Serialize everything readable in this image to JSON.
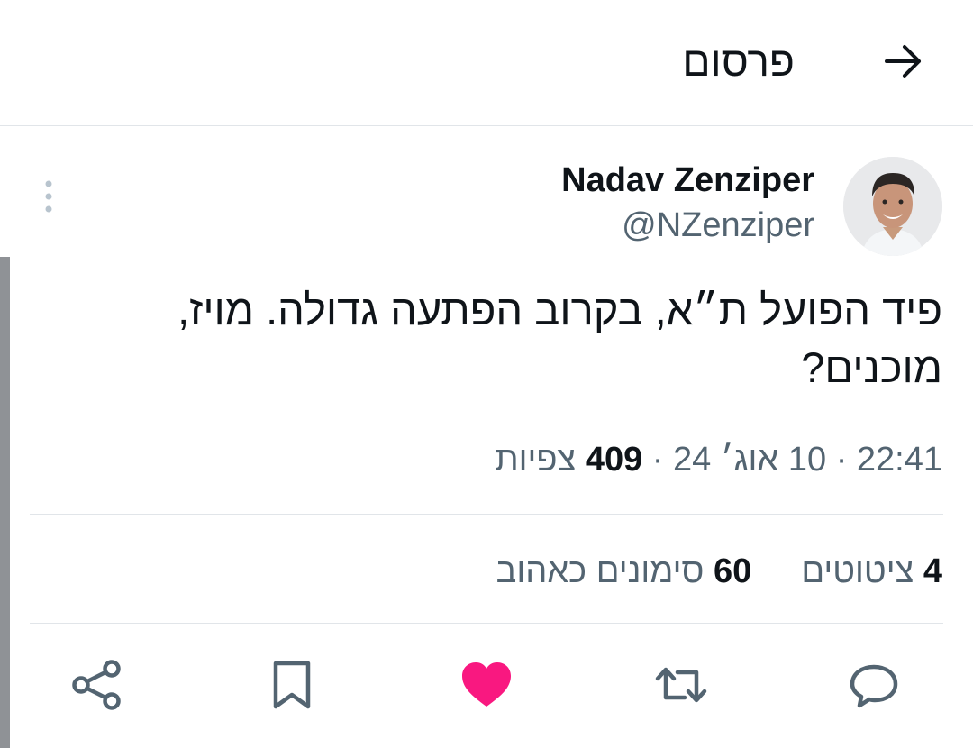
{
  "header": {
    "title": "פרסום",
    "back_icon": "arrow-right-icon"
  },
  "tweet": {
    "author_name": "Nadav Zenziper",
    "author_handle": "@NZenziper",
    "text": "פיד הפועל ת״א, בקרוב הפתעה גדולה. מויז, מוכנים?",
    "time": "22:41",
    "date": "10 אוג׳ 24",
    "views_count": "409",
    "views_label": "צפיות",
    "separator": "·"
  },
  "stats": {
    "quotes_count": "4",
    "quotes_label": "ציטוטים",
    "likes_count": "60",
    "likes_label": "סימונים כאהוב"
  },
  "actions": {
    "reply_icon": "reply-icon",
    "retweet_icon": "retweet-icon",
    "like_icon": "heart-icon",
    "bookmark_icon": "bookmark-icon",
    "share_icon": "share-icon",
    "like_color": "#f91880",
    "icon_color": "#536471"
  }
}
